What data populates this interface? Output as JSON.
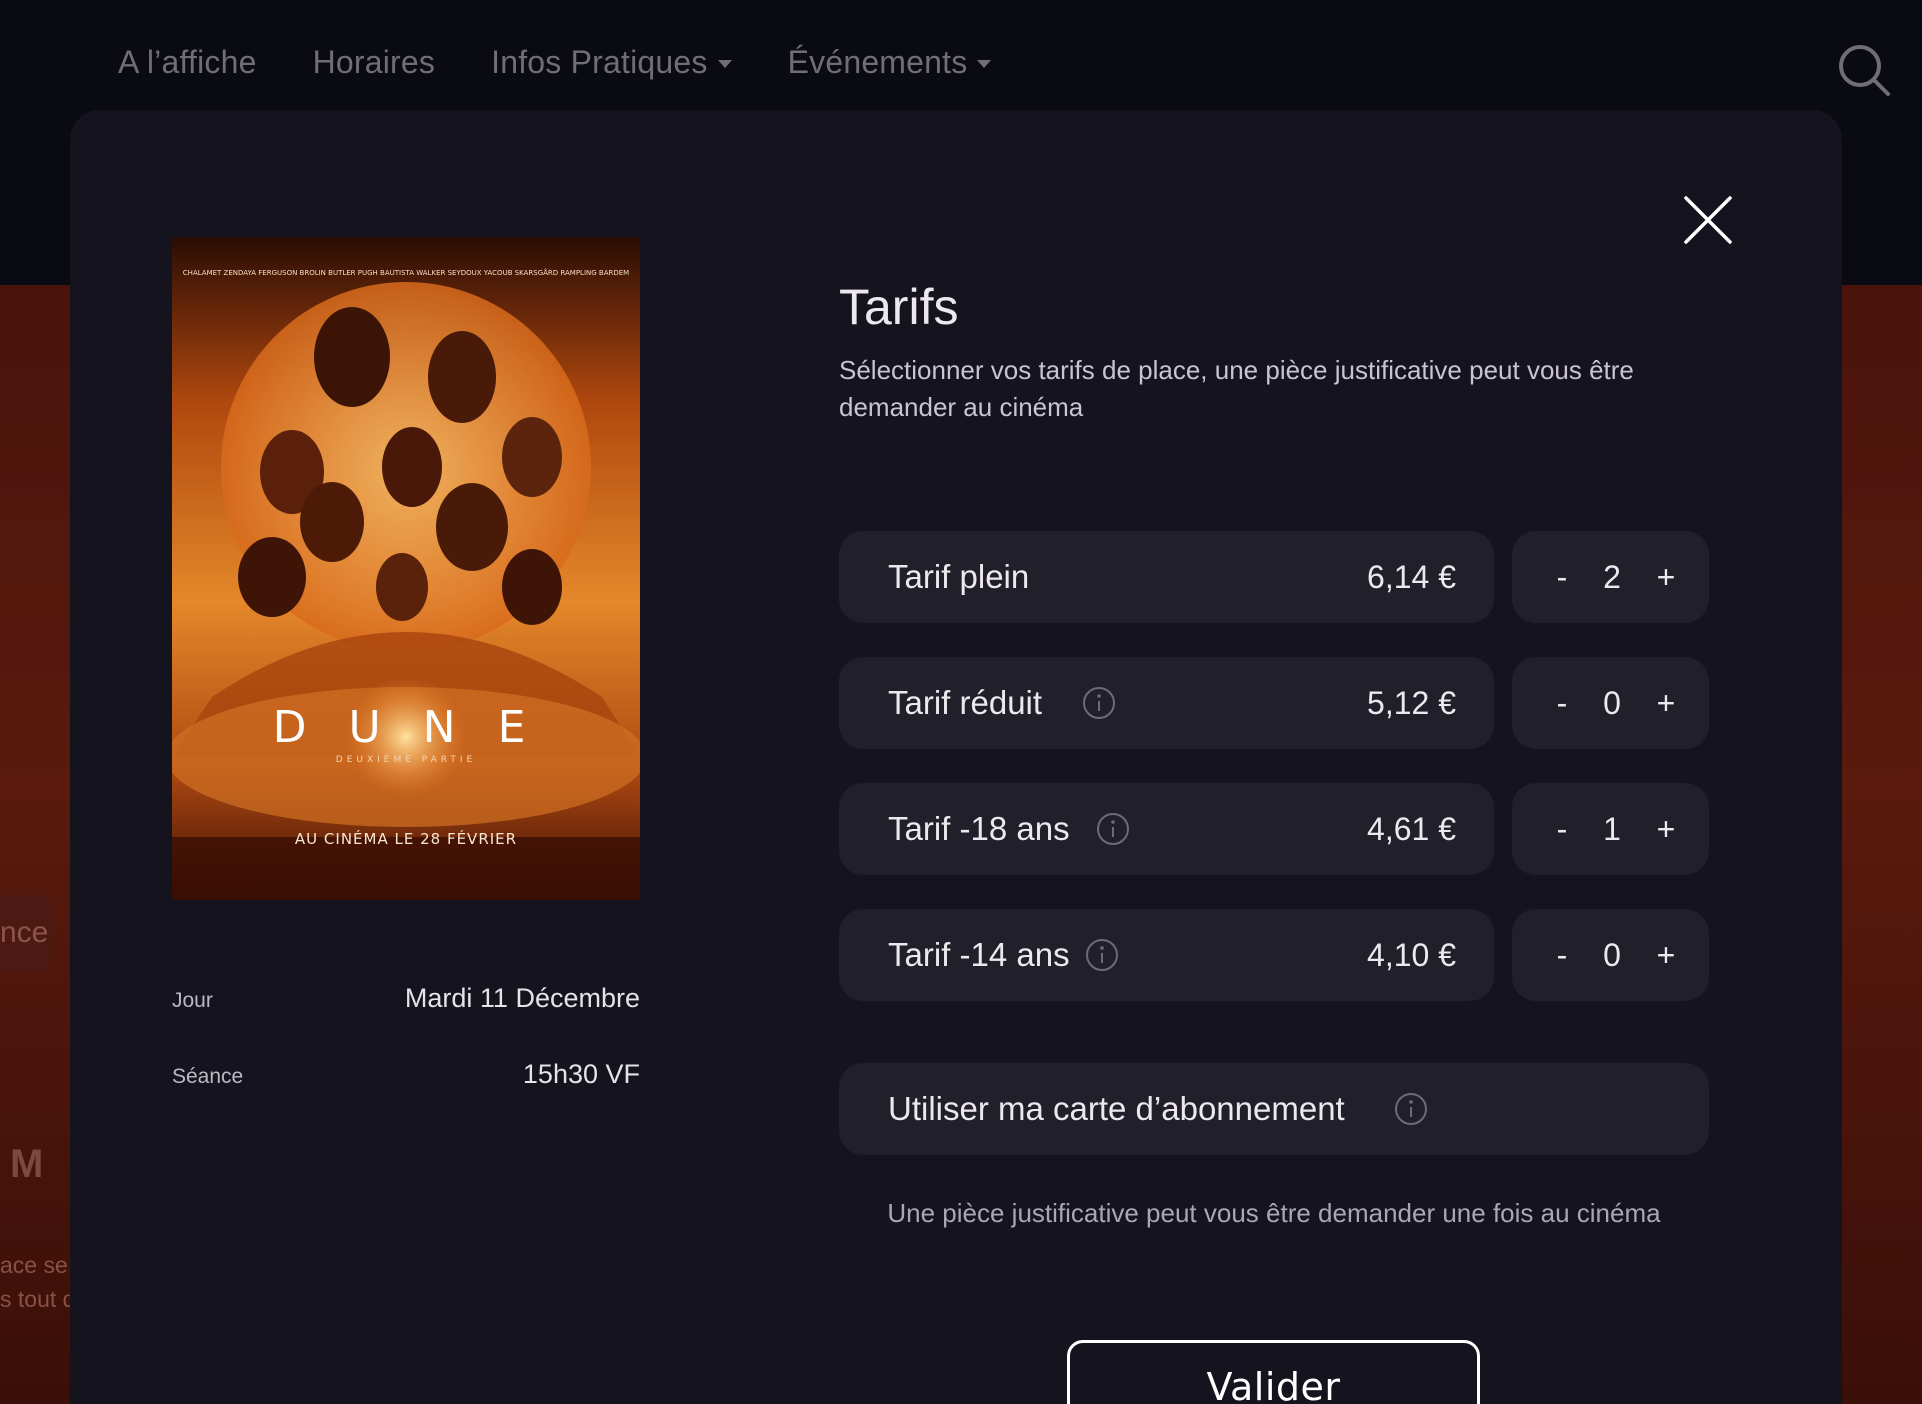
{
  "nav": {
    "items": [
      {
        "label": "A l’affiche",
        "has_caret": false
      },
      {
        "label": "Horaires",
        "has_caret": false
      },
      {
        "label": "Infos Pratiques",
        "has_caret": true
      },
      {
        "label": "Événements",
        "has_caret": true
      }
    ],
    "search_icon": "search-icon"
  },
  "background": {
    "button_fragment": "nce",
    "letter_fragment": "M",
    "text_fragment_1": "ace se",
    "text_fragment_2": "s tout d"
  },
  "modal": {
    "close_icon": "close-icon",
    "poster": {
      "title_text": "D U N E",
      "subtitle_text": "DEUXIÈME PARTIE",
      "tagline": "AU CINÉMA LE 28 FÉVRIER",
      "colors": {
        "sky": "#f0a040",
        "sun": "#f7b45a",
        "dark": "#3a0e04"
      }
    },
    "session": {
      "day_label": "Jour",
      "day_value": "Mardi 11 Décembre",
      "show_label": "Séance",
      "show_value": "15h30 VF"
    },
    "title": "Tarifs",
    "subtitle": "Sélectionner vos tarifs de place, une pièce justificative peut vous être demander au cinéma",
    "tariffs": [
      {
        "name": "Tarif plein",
        "price": "6,14 €",
        "quantity": "2",
        "has_info": false
      },
      {
        "name": "Tarif réduit",
        "price": "5,12 €",
        "quantity": "0",
        "has_info": true
      },
      {
        "name": "Tarif -18 ans",
        "price": "4,61 €",
        "quantity": "1",
        "has_info": true
      },
      {
        "name": "Tarif -14 ans",
        "price": "4,10 €",
        "quantity": "0",
        "has_info": true
      }
    ],
    "stepper": {
      "minus": "-",
      "plus": "+"
    },
    "subscription_label": "Utiliser ma carte d’abonnement",
    "note": "Une pièce justificative peut vous être demander une fois au cinéma",
    "validate_label": "Valider"
  },
  "colors": {
    "modal_bg": "#14131e",
    "card_bg": "#211f29",
    "text": "#ece8ee",
    "muted": "#aba6b2"
  }
}
